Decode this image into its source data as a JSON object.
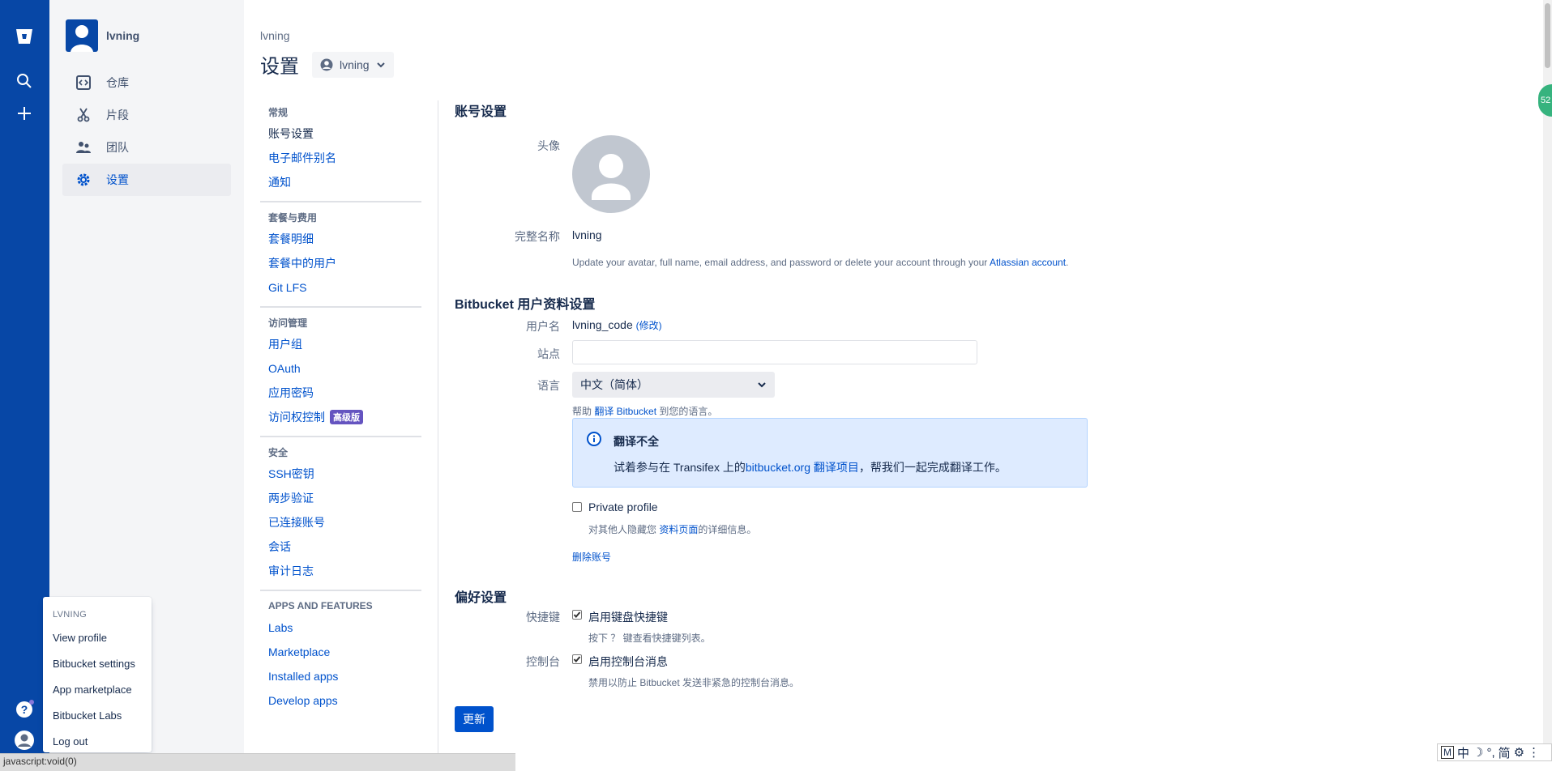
{
  "global_nav": {
    "notification_badge_color": "#8777d9"
  },
  "container_nav": {
    "user_name": "lvning",
    "items": [
      {
        "label": "仓库",
        "icon": "code-icon"
      },
      {
        "label": "片段",
        "icon": "scissors-icon"
      },
      {
        "label": "团队",
        "icon": "people-icon"
      },
      {
        "label": "设置",
        "icon": "gear-icon"
      }
    ]
  },
  "account_menu": {
    "heading": "LVNING",
    "items": [
      "View profile",
      "Bitbucket settings",
      "App marketplace",
      "Bitbucket Labs",
      "Log out"
    ]
  },
  "status_bar": "javascript:void(0)",
  "ime_bar": [
    "M",
    "中",
    "☽",
    "°,",
    "简",
    "⚙",
    "⋮"
  ],
  "header": {
    "breadcrumb": "lvning",
    "title": "设置",
    "account_switcher": "lvning"
  },
  "settings_nav": {
    "groups": [
      {
        "heading": "常规",
        "links": [
          "账号设置",
          "电子邮件别名",
          "通知"
        ]
      },
      {
        "heading": "套餐与费用",
        "links": [
          "套餐明细",
          "套餐中的用户",
          "Git LFS"
        ]
      },
      {
        "heading": "访问管理",
        "links": [
          "用户组",
          "OAuth",
          "应用密码",
          "访问权控制"
        ]
      },
      {
        "heading": "安全",
        "links": [
          "SSH密钥",
          "两步验证",
          "已连接账号",
          "会话",
          "审计日志"
        ]
      },
      {
        "heading": "APPS AND FEATURES",
        "links": [
          "Labs",
          "Marketplace",
          "Installed apps",
          "Develop apps"
        ]
      }
    ],
    "premium_lozenge": "高级版"
  },
  "account_settings": {
    "title": "账号设置",
    "avatar_label": "头像",
    "fullname_label": "完整名称",
    "fullname_value": "lvning",
    "update_note_prefix": "Update your avatar, full name, email address, and password or delete your account through your ",
    "update_note_link": "Atlassian account",
    "update_note_suffix": "."
  },
  "profile_settings": {
    "title": "Bitbucket 用户资料设置",
    "username_label": "用户名",
    "username_value": "lvning_code",
    "username_change": "(修改)",
    "website_label": "站点",
    "website_value": "",
    "language_label": "语言",
    "language_value": "中文（简体）",
    "help_prefix": "帮助 ",
    "help_link": "翻译 Bitbucket",
    "help_suffix": " 到您的语言。",
    "info_title": "翻译不全",
    "info_body_prefix": "试着参与在 Transifex 上的",
    "info_body_link1": "bitbucket.org",
    "info_body_mid": " ",
    "info_body_link2": "翻译项目",
    "info_body_suffix": "，帮我们一起完成翻译工作。",
    "private_label": "Private profile",
    "private_checked": false,
    "private_desc_prefix": "对其他人隐藏您 ",
    "private_desc_link": "资料页面",
    "private_desc_suffix": "的详细信息。",
    "delete_account": "删除账号"
  },
  "preferences": {
    "title": "偏好设置",
    "shortcut_label": "快捷键",
    "shortcut_option": "启用键盘快捷键",
    "shortcut_checked": true,
    "shortcut_desc": "按下 ？ 键查看快捷键列表。",
    "console_label": "控制台",
    "console_option": "启用控制台消息",
    "console_checked": true,
    "console_desc": "禁用以防止 Bitbucket 发送非紧急的控制台消息。"
  },
  "update_button": "更新",
  "side_badge": "52"
}
